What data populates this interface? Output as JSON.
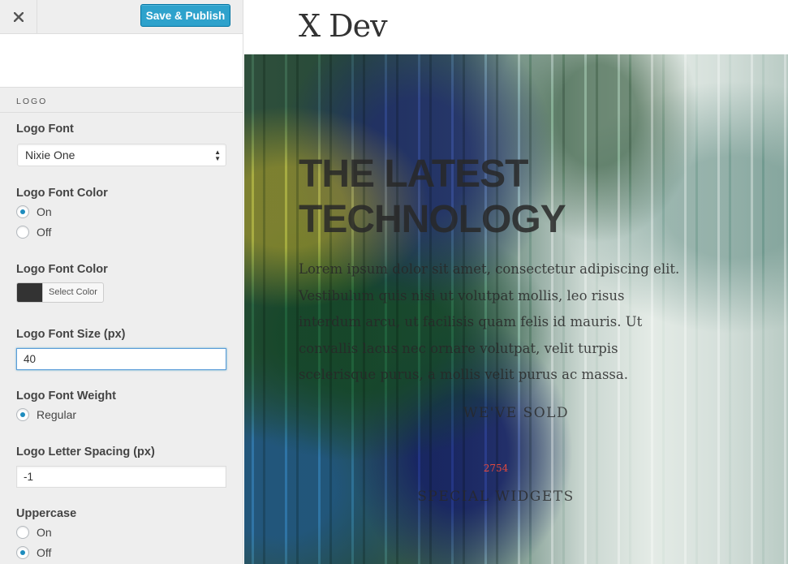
{
  "toolbar": {
    "close_icon": "close-icon",
    "publish_label": "Save & Publish",
    "publish_color": "#2ea2cc"
  },
  "section": {
    "title": "LOGO"
  },
  "controls": {
    "logo_font": {
      "label": "Logo Font",
      "value": "Nixie One"
    },
    "logo_font_color_toggle": {
      "label": "Logo Font Color",
      "options": [
        "On",
        "Off"
      ],
      "selected": "On"
    },
    "logo_font_color": {
      "label": "Logo Font Color",
      "button_label": "Select Color",
      "swatch": "#333333"
    },
    "logo_font_size": {
      "label": "Logo Font Size (px)",
      "value": "40"
    },
    "logo_font_weight": {
      "label": "Logo Font Weight",
      "options": [
        "Regular"
      ],
      "selected": "Regular"
    },
    "logo_letter_spacing": {
      "label": "Logo Letter Spacing (px)",
      "value": "-1"
    },
    "uppercase": {
      "label": "Uppercase",
      "options": [
        "On",
        "Off"
      ],
      "selected": "Off"
    }
  },
  "preview": {
    "site_title": "X Dev",
    "hero_title": "THE LATEST TECHNOLOGY",
    "hero_body": "Lorem ipsum dolor sit amet, consectetur adipiscing elit. Vestibulum quis nisi ut volutpat mollis, leo risus interdum arcu, ut facilisis quam felis id mauris. Ut convallis lacus nec ornare volutpat, velit turpis scelerisque purus, a mollis velit purus ac massa.",
    "sold_title": "WE'VE SOLD",
    "sold_count": "2754",
    "sold_sub": "SPECIAL WIDGETS",
    "accent_color": "#e2483d"
  }
}
